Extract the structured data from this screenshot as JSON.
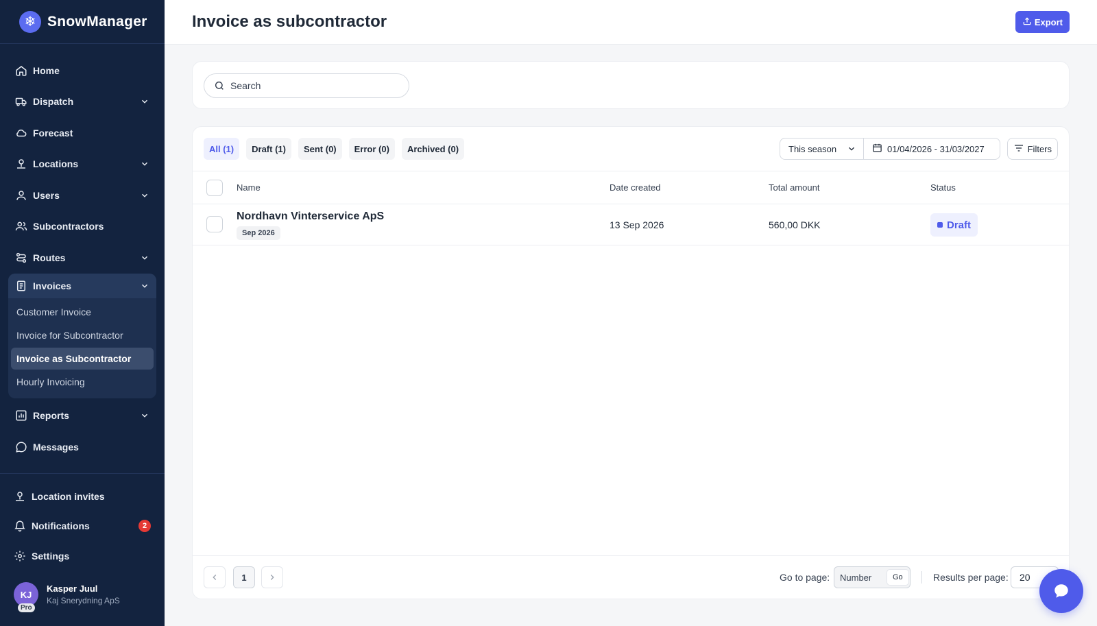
{
  "app": {
    "name": "SnowManager"
  },
  "nav": {
    "home": "Home",
    "dispatch": "Dispatch",
    "forecast": "Forecast",
    "locations": "Locations",
    "users": "Users",
    "subcontractors": "Subcontractors",
    "routes": "Routes",
    "invoices": "Invoices",
    "invoices_sub": [
      "Customer Invoice",
      "Invoice for Subcontractor",
      "Invoice as Subcontractor",
      "Hourly Invoicing"
    ],
    "reports": "Reports",
    "messages": "Messages",
    "location_invites": "Location invites",
    "notifications": "Notifications",
    "notifications_count": "2",
    "settings": "Settings"
  },
  "user": {
    "initials": "KJ",
    "plan": "Pro",
    "name": "Kasper Juul",
    "company": "Kaj Snerydning ApS"
  },
  "header": {
    "title": "Invoice as subcontractor",
    "export_label": "Export"
  },
  "search": {
    "placeholder": "Search"
  },
  "tabs": [
    {
      "label": "All (1)"
    },
    {
      "label": "Draft (1)"
    },
    {
      "label": "Sent (0)"
    },
    {
      "label": "Error (0)"
    },
    {
      "label": "Archived (0)"
    }
  ],
  "filters": {
    "season": "This season",
    "date_range": "01/04/2026 - 31/03/2027",
    "filters_label": "Filters"
  },
  "table": {
    "columns": [
      "Name",
      "Date created",
      "Total amount",
      "Status"
    ],
    "rows": [
      {
        "name": "Nordhavn Vinterservice ApS",
        "period": "Sep 2026",
        "date": "13 Sep 2026",
        "amount": "560,00 DKK",
        "status": "Draft"
      }
    ]
  },
  "pagination": {
    "current_page": "1",
    "goto_label": "Go to page:",
    "goto_placeholder": "Number",
    "go_label": "Go",
    "rpp_label": "Results per page:",
    "rpp_value": "20"
  },
  "colors": {
    "sidebar": "#13233f",
    "accent": "#4f5bea",
    "badge": "#e53935"
  }
}
